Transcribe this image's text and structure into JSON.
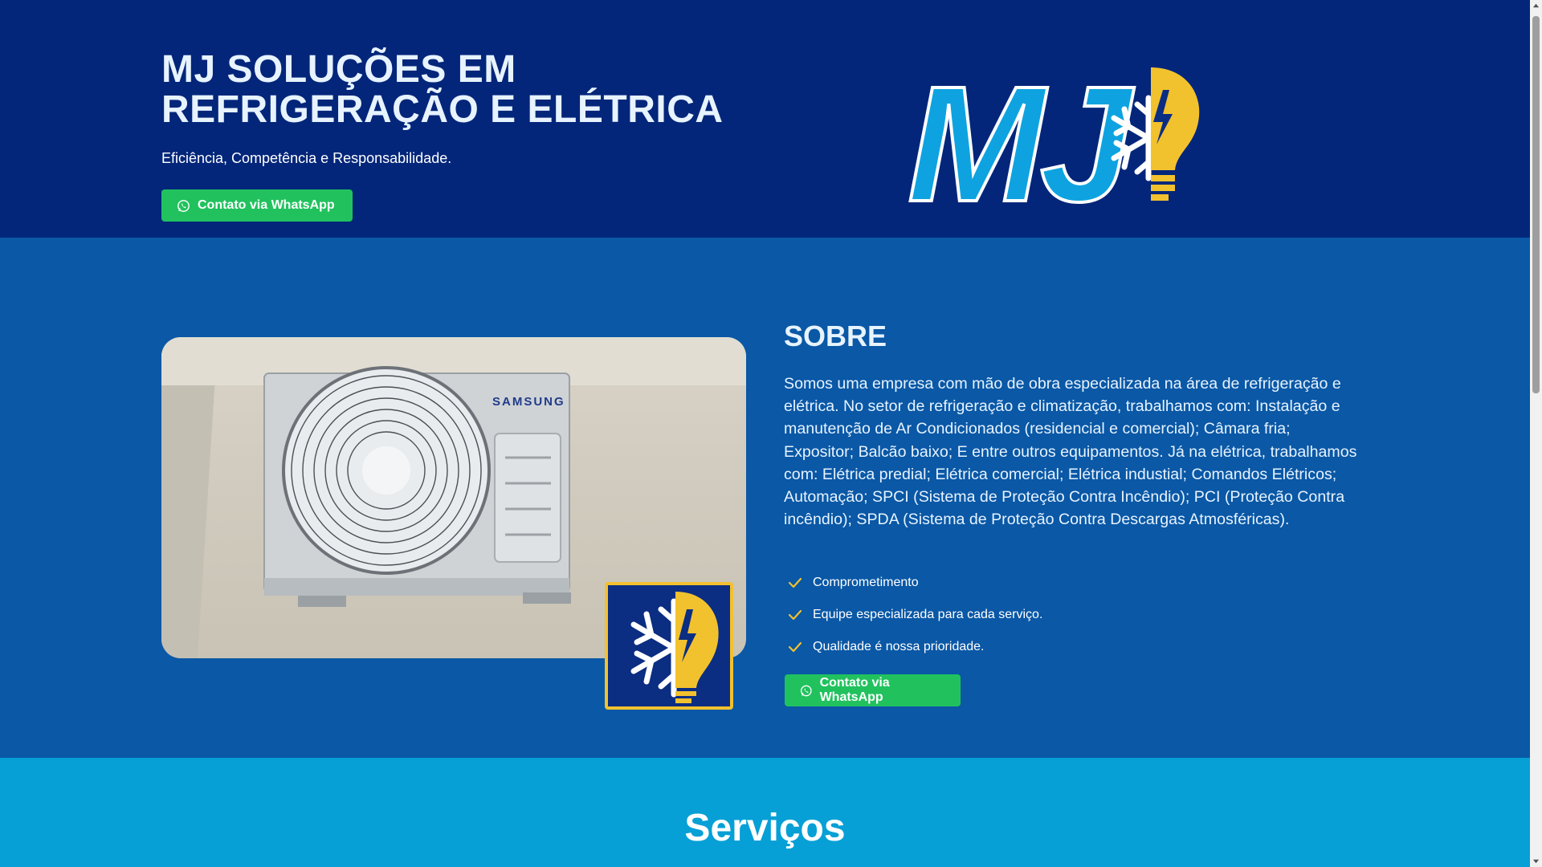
{
  "hero": {
    "title": "MJ SOLUÇÕES EM REFRIGERAÇÃO E ELÉTRICA",
    "subtitle": "Eficiência, Competência e Responsabilidade.",
    "cta_label": "Contato via WhatsApp",
    "logo_text": "MJ"
  },
  "about": {
    "title": "SOBRE",
    "text": "Somos uma empresa com mão de obra especializada na área de refrigeração e elétrica. No setor de refrigeração e climatização, trabalhamos com: Instalação e manutenção de Ar Condicionados (residencial e comercial); Câmara fria; Expositor; Balcão baixo; E entre outros equipamentos. Já na elétrica, trabalhamos com: Elétrica predial; Elétrica comercial; Elétrica industial; Comandos Elétricos; Automação; SPCI (Sistema de Proteção Contra Incêndio); PCI (Proteção Contra incêndio); SPDA (Sistema de Proteção Contra Descargas Atmosféricas).",
    "checklist": [
      "Comprometimento",
      "Equipe especializada para cada serviço.",
      "Qualidade é nossa prioridade."
    ],
    "cta_label": "Contato via WhatsApp",
    "photo_brand_text": "SAMSUNG"
  },
  "services": {
    "title": "Serviços"
  },
  "colors": {
    "hero_bg": "#03267a",
    "about_bg": "#0a58a6",
    "services_bg": "#06a0d6",
    "whatsapp_green": "#21c25e",
    "logo_blue": "#0ea3e0",
    "logo_yellow": "#f2c12e"
  }
}
